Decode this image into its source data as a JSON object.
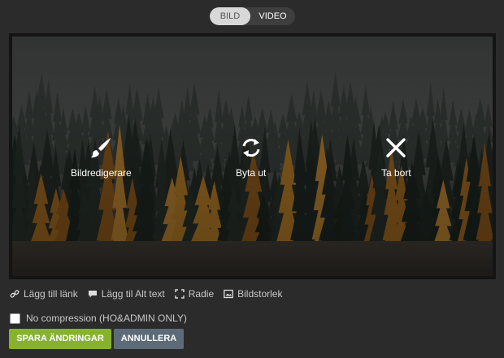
{
  "toggle": {
    "image_label": "BILD",
    "video_label": "VIDEO",
    "selected": "BILD"
  },
  "image_actions": {
    "edit": {
      "label": "Bildredigerare",
      "icon": "paintbrush-icon"
    },
    "replace": {
      "label": "Byta ut",
      "icon": "refresh-icon"
    },
    "remove": {
      "label": "Ta bort",
      "icon": "close-icon"
    }
  },
  "links": {
    "add_link": {
      "label": "Lägg till länk",
      "icon": "link-icon"
    },
    "alt_text": {
      "label": "Lägg til Alt text",
      "icon": "comment-icon"
    },
    "radius": {
      "label": "Radie",
      "icon": "corners-icon"
    },
    "image_size": {
      "label": "Bildstorlek",
      "icon": "image-icon"
    }
  },
  "compression": {
    "label": "No compression (HO&ADMIN ONLY)",
    "checked": false
  },
  "buttons": {
    "save": "SPARA ÄNDRINGAR",
    "cancel": "ANNULLERA"
  },
  "colors": {
    "save": "#86b22d",
    "cancel": "#5d6a78",
    "background": "#2b2b2b"
  }
}
